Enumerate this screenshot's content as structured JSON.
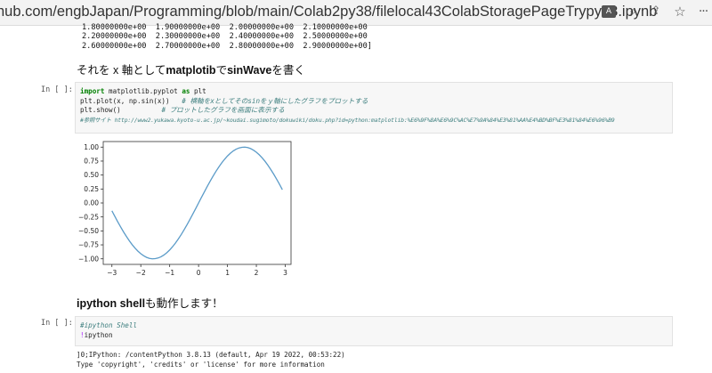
{
  "browser": {
    "url": "hub.com/engbJapan/Programming/blob/main/Colab2py38/filelocal43ColabStoragePageTrypy38.ipynb",
    "icons": [
      "translate-icon",
      "zoom-icon",
      "share-icon",
      "favorite-star-icon",
      "more-icon"
    ]
  },
  "notebook": {
    "output_top": [
      "1.80000000e+00  1.90000000e+00  2.00000000e+00  2.10000000e+00",
      "2.20000000e+00  2.30000000e+00  2.40000000e+00  2.50000000e+00",
      "2.60000000e+00  2.70000000e+00  2.80000000e+00  2.90000000e+00]"
    ],
    "markdown1": {
      "pre": "それを x 軸として",
      "bold": "matplotib",
      "mid": "で",
      "bold2": "sinWave",
      "post": "を書く"
    },
    "cell1": {
      "prompt": "In [ ]:",
      "line1_kw": "import",
      "line1_rest": " matplotlib.pyplot ",
      "line1_kw2": "as",
      "line1_end": " plt",
      "line2_code": "plt.plot(x, np.sin(x))   ",
      "line2_comment": "# 横軸をxとしてそのsinをｙ軸にしたグラフをプロットする",
      "line3_code": "plt.show()          ",
      "line3_comment": "# プロットしたグラフを画面に表示する",
      "line4_comment": "#参照サイト http://www2.yukawa.kyoto-u.ac.jp/~koudai.sugimoto/dokuwiki/doku.php?id=python:matplotlib:%E6%9F%8A%E6%9C%AC%E7%9A%84%E3%81%AA%E4%BD%BF%E3%81%84%E6%96%B9"
    },
    "markdown2": {
      "bold": "ipython shell",
      "post": "も動作します！"
    },
    "cell2": {
      "prompt": "In [ ]:",
      "line1_comment": "#ipython Shell",
      "line2_bang": "!",
      "line2_rest": "ipython"
    },
    "output_bottom": [
      "]0;IPython: /contentPython 3.8.13 (default, Apr 19 2022, 00:53:22)",
      "Type 'copyright', 'credits' or 'license' for more information"
    ]
  },
  "chart_data": {
    "type": "line",
    "function": "sin(x)",
    "x": [
      -3.0,
      -2.9,
      -2.8,
      -2.7,
      -2.6,
      -2.5,
      -2.4,
      -2.3,
      -2.2,
      -2.1,
      -2.0,
      -1.9,
      -1.8,
      -1.7,
      -1.6,
      -1.5,
      -1.4,
      -1.3,
      -1.2,
      -1.1,
      -1.0,
      -0.9,
      -0.8,
      -0.7,
      -0.6,
      -0.5,
      -0.4,
      -0.3,
      -0.2,
      -0.1,
      0.0,
      0.1,
      0.2,
      0.3,
      0.4,
      0.5,
      0.6,
      0.7,
      0.8,
      0.9,
      1.0,
      1.1,
      1.2,
      1.3,
      1.4,
      1.5,
      1.6,
      1.7,
      1.8,
      1.9,
      2.0,
      2.1,
      2.2,
      2.3,
      2.4,
      2.5,
      2.6,
      2.7,
      2.8,
      2.9
    ],
    "y": [
      -0.141,
      -0.239,
      -0.335,
      -0.427,
      -0.516,
      -0.598,
      -0.675,
      -0.746,
      -0.808,
      -0.863,
      -0.909,
      -0.946,
      -0.974,
      -0.992,
      -1.0,
      -0.997,
      -0.985,
      -0.964,
      -0.932,
      -0.891,
      -0.841,
      -0.783,
      -0.717,
      -0.644,
      -0.565,
      -0.479,
      -0.389,
      -0.296,
      -0.199,
      -0.1,
      0.0,
      0.1,
      0.199,
      0.296,
      0.389,
      0.479,
      0.565,
      0.644,
      0.717,
      0.783,
      0.841,
      0.891,
      0.932,
      0.964,
      0.985,
      0.997,
      1.0,
      0.992,
      0.974,
      0.946,
      0.909,
      0.863,
      0.808,
      0.746,
      0.675,
      0.598,
      0.516,
      0.427,
      0.335,
      0.239
    ],
    "xlim": [
      -3.3,
      3.2
    ],
    "ylim": [
      -1.1,
      1.1
    ],
    "xticks": [
      -3,
      -2,
      -1,
      0,
      1,
      2,
      3
    ],
    "xtick_labels": [
      "−3",
      "−2",
      "−1",
      "0",
      "1",
      "2",
      "3"
    ],
    "yticks": [
      -1.0,
      -0.75,
      -0.5,
      -0.25,
      0.0,
      0.25,
      0.5,
      0.75,
      1.0
    ],
    "ytick_labels": [
      "−1.00",
      "−0.75",
      "−0.50",
      "−0.25",
      "0.00",
      "0.25",
      "0.50",
      "0.75",
      "1.00"
    ],
    "line_color": "#5b9bc8",
    "grid": false,
    "title": "",
    "xlabel": "",
    "ylabel": ""
  }
}
